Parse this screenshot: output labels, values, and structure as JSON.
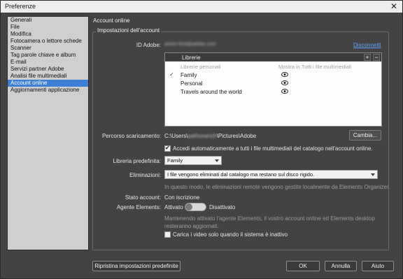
{
  "window": {
    "title": "Preferenze",
    "close_glyph": "✕"
  },
  "sidebar": {
    "items": [
      {
        "label": "Generali",
        "selected": false
      },
      {
        "label": "File",
        "selected": false
      },
      {
        "label": "Modifica",
        "selected": false
      },
      {
        "label": "Fotocamera o lettore schede",
        "selected": false
      },
      {
        "label": "Scanner",
        "selected": false
      },
      {
        "label": "Tag parole chiave e album",
        "selected": false
      },
      {
        "label": "E-mail",
        "selected": false
      },
      {
        "label": "Servizi partner Adobe",
        "selected": false
      },
      {
        "label": "Analisi file multimediali",
        "selected": false
      },
      {
        "label": "Account online",
        "selected": true
      },
      {
        "label": "Aggiornamenti applicazione",
        "selected": false
      }
    ]
  },
  "panel": {
    "title": "Account online",
    "group_title": "Impostazioni dell'account",
    "adobe_id_label": "ID Adobe:",
    "adobe_id_value": "anish+first@adobe.com",
    "disconnect_link": "Disconnetti",
    "libraries": {
      "header": "Librerie",
      "add_glyph": "+",
      "remove_glyph": "−",
      "col_personal": "Librerie personali",
      "col_show": "Mostra in Tutti i file multimediali",
      "check_glyph": "✓",
      "rows": [
        {
          "name": "Family",
          "checked": true
        },
        {
          "name": "Personal",
          "checked": false
        },
        {
          "name": "Travels around the world",
          "checked": false
        }
      ]
    },
    "download_path_label": "Percorso scaricamento:",
    "download_path_prefix": "C:\\Users\\",
    "download_path_user": "pathorwrich",
    "download_path_suffix": "\\Pictures\\Adobe",
    "change_button": "Cambia...",
    "auto_access_label": "Accedi automaticamente a tutti i file multimediali del catalogo nell'account online.",
    "auto_access_checked": true,
    "default_library_label": "Libreria predefinita:",
    "default_library_value": "Family",
    "deletions_label": "Eliminazioni:",
    "deletions_value": "I file vengono eliminati dal catalogo ma restano sul disco rigido.",
    "deletions_note": "In questo modo, le eliminazioni remote vengono gestite localmente da Elements Organizer.",
    "account_status_label": "Stato account:",
    "account_status_value": "Con iscrizione",
    "agent_label": "Agente Elements:",
    "agent_on_label": "Attivato",
    "agent_off_label": "Disattivato",
    "agent_note_line1": "Mantenendo attivato l'agente Elements, il vostro account online ed Elements desktop",
    "agent_note_line2": "resteranno aggiornati.",
    "idle_upload_label": "Carica i video solo quando il sistema è inattivo",
    "idle_upload_checked": false
  },
  "footer": {
    "reset_button": "Ripristina impostazioni predefinite",
    "ok_button": "OK",
    "cancel_button": "Annulla",
    "help_button": "Aiuto"
  }
}
